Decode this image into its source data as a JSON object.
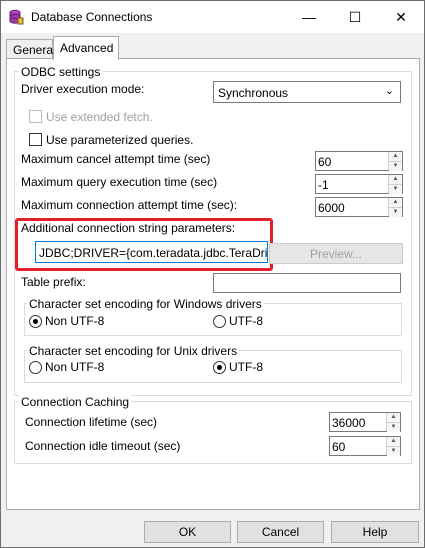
{
  "window": {
    "title": "Database Connections",
    "minimize_icon": "minimize-icon",
    "maximize_icon": "maximize-icon",
    "close_icon": "close-icon"
  },
  "tabs": [
    {
      "label": "General"
    },
    {
      "label": "Advanced"
    }
  ],
  "odbc": {
    "group_label": "ODBC settings",
    "driver_mode_label": "Driver execution mode:",
    "driver_mode_value": "Synchronous",
    "extended_fetch_label": "Use extended fetch.",
    "param_queries_label": "Use parameterized queries.",
    "max_cancel_label": "Maximum cancel attempt time (sec)",
    "max_cancel_value": "60",
    "max_query_label": "Maximum query execution time (sec)",
    "max_query_value": "-1",
    "max_conn_label": "Maximum connection attempt time (sec):",
    "max_conn_value": "6000",
    "conn_string_label": "Additional connection string parameters:",
    "conn_string_value": "JDBC;DRIVER={com.teradata.jdbc.TeraDriver}",
    "preview_label": "Preview...",
    "table_prefix_label": "Table prefix:",
    "table_prefix_value": "",
    "win_charset_label": "Character set encoding for Windows drivers",
    "win_non_utf8": "Non UTF-8",
    "win_utf8": "UTF-8",
    "unix_charset_label": "Character set encoding for Unix drivers",
    "unix_non_utf8": "Non UTF-8",
    "unix_utf8": "UTF-8"
  },
  "caching": {
    "group_label": "Connection Caching",
    "lifetime_label": "Connection lifetime (sec)",
    "lifetime_value": "36000",
    "idle_label": "Connection idle timeout (sec)",
    "idle_value": "60"
  },
  "buttons": {
    "ok": "OK",
    "cancel": "Cancel",
    "help": "Help"
  },
  "colors": {
    "highlight": "#e0202a",
    "focus": "#0078d7"
  }
}
